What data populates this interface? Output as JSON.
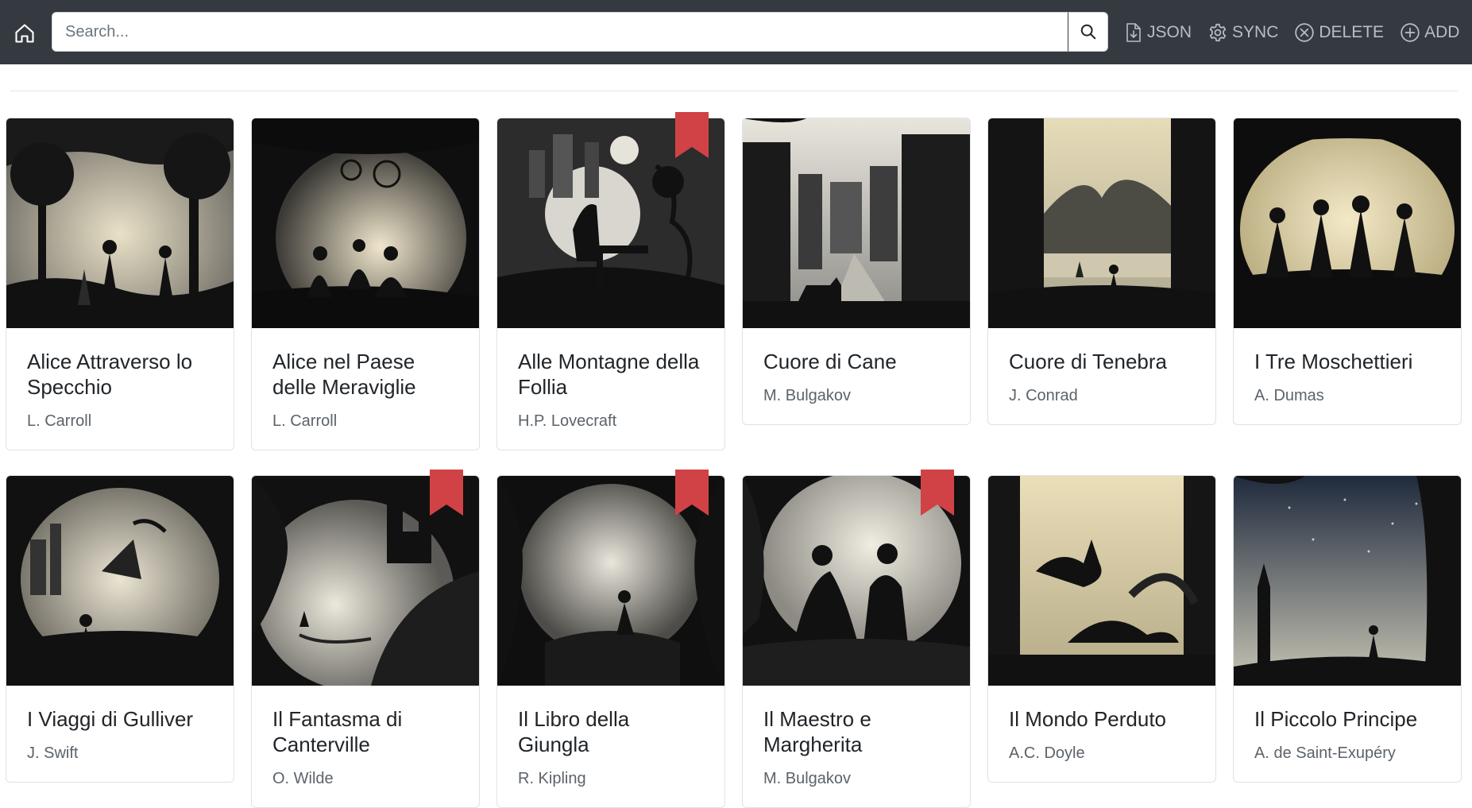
{
  "navbar": {
    "search_placeholder": "Search...",
    "actions": [
      {
        "label": "JSON",
        "icon": "file-download-icon"
      },
      {
        "label": "SYNC",
        "icon": "gear-icon"
      },
      {
        "label": "DELETE",
        "icon": "x-circle-icon"
      },
      {
        "label": "ADD",
        "icon": "plus-circle-icon"
      }
    ]
  },
  "colors": {
    "navbar": "#343a40",
    "bookmark": "#d04245",
    "author_text": "#5c636a"
  },
  "books": [
    {
      "title": "Alice Attraverso lo Specchio",
      "author": "L. Carroll",
      "bookmarked": false
    },
    {
      "title": "Alice nel Paese delle Meraviglie",
      "author": "L. Carroll",
      "bookmarked": false
    },
    {
      "title": "Alle Montagne della Follia",
      "author": "H.P. Lovecraft",
      "bookmarked": true
    },
    {
      "title": "Cuore di Cane",
      "author": "M. Bulgakov",
      "bookmarked": false
    },
    {
      "title": "Cuore di Tenebra",
      "author": "J. Conrad",
      "bookmarked": false
    },
    {
      "title": "I Tre Moschettieri",
      "author": "A. Dumas",
      "bookmarked": false
    },
    {
      "title": "I Viaggi di Gulliver",
      "author": "J. Swift",
      "bookmarked": false
    },
    {
      "title": "Il Fantasma di Canterville",
      "author": "O. Wilde",
      "bookmarked": true
    },
    {
      "title": "Il Libro della Giungla",
      "author": "R. Kipling",
      "bookmarked": true
    },
    {
      "title": "Il Maestro e Margherita",
      "author": "M. Bulgakov",
      "bookmarked": true
    },
    {
      "title": "Il Mondo Perduto",
      "author": "A.C. Doyle",
      "bookmarked": false
    },
    {
      "title": "Il Piccolo Principe",
      "author": "A. de Saint-Exupéry",
      "bookmarked": false
    }
  ]
}
